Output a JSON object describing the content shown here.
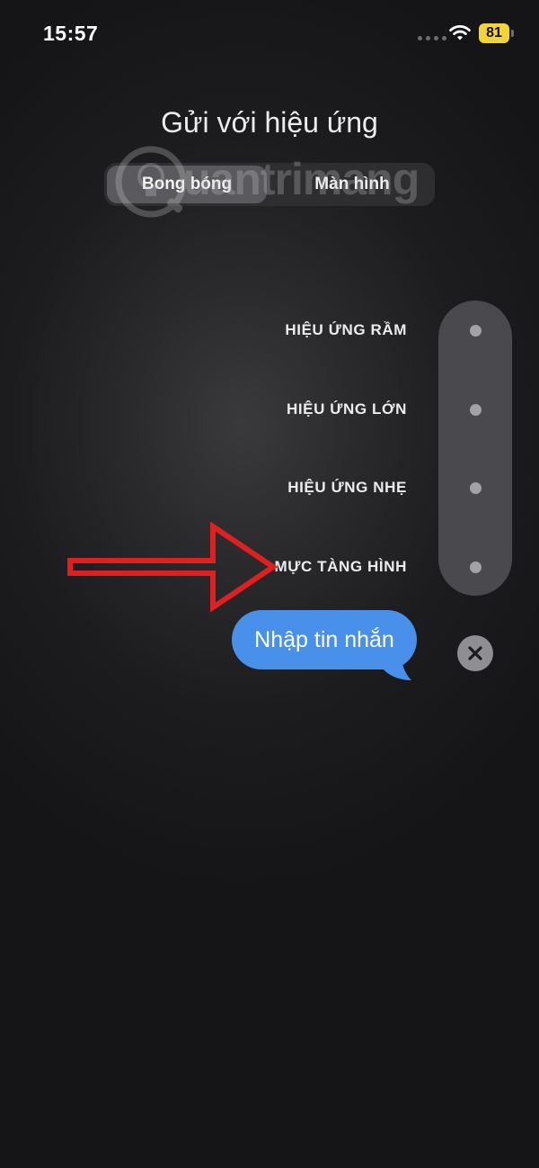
{
  "status_bar": {
    "time": "15:57",
    "battery": "81",
    "signal_icon": "cellular-dots-icon",
    "wifi_icon": "wifi-icon"
  },
  "title": "Gửi với hiệu ứng",
  "tabs": [
    {
      "label": "Bong bóng",
      "selected": true
    },
    {
      "label": "Màn hình",
      "selected": false
    }
  ],
  "watermark": {
    "text": "uantrimang",
    "icon": "lightbulb-logo-icon"
  },
  "effects": [
    {
      "label": "HIỆU ỨNG RẦM"
    },
    {
      "label": "HIỆU ỨNG LỚN"
    },
    {
      "label": "HIỆU ỨNG NHẸ"
    },
    {
      "label": "MỰC TÀNG HÌNH"
    }
  ],
  "annotation": {
    "icon": "red-arrow-icon",
    "color": "#e02020"
  },
  "message": {
    "text": "Nhập tin nhắn",
    "bubble_color": "#4890ea"
  },
  "close_icon": "close-icon",
  "colors": {
    "background": "#1c1c1e",
    "accent_blue": "#4890ea",
    "battery_yellow": "#f2d33a"
  }
}
